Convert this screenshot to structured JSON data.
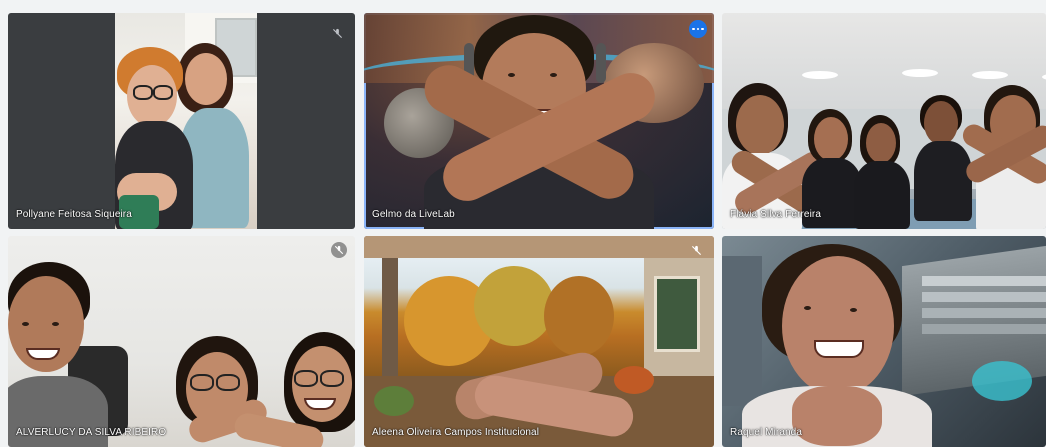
{
  "participants": [
    {
      "name": "Pollyane Feitosa Siqueira",
      "muted": true,
      "active": false
    },
    {
      "name": "Gelmo da LiveLab",
      "muted": false,
      "active": true
    },
    {
      "name": "Flávia Silva Ferreira",
      "muted": false,
      "active": false
    },
    {
      "name": "ALVERLUCY DA SILVA RIBEIRO",
      "muted": true,
      "active": false
    },
    {
      "name": "Aleena Oliveira Campos Institucional",
      "muted": true,
      "active": false
    },
    {
      "name": "Raquel Miranda",
      "muted": false,
      "active": false
    }
  ],
  "icons": {
    "mute": "mic-off-icon",
    "more": "more-options-icon"
  },
  "colors": {
    "tile_bg": "#3c4043",
    "active_outline": "#8ab4f8",
    "more_button": "#1a73e8"
  }
}
